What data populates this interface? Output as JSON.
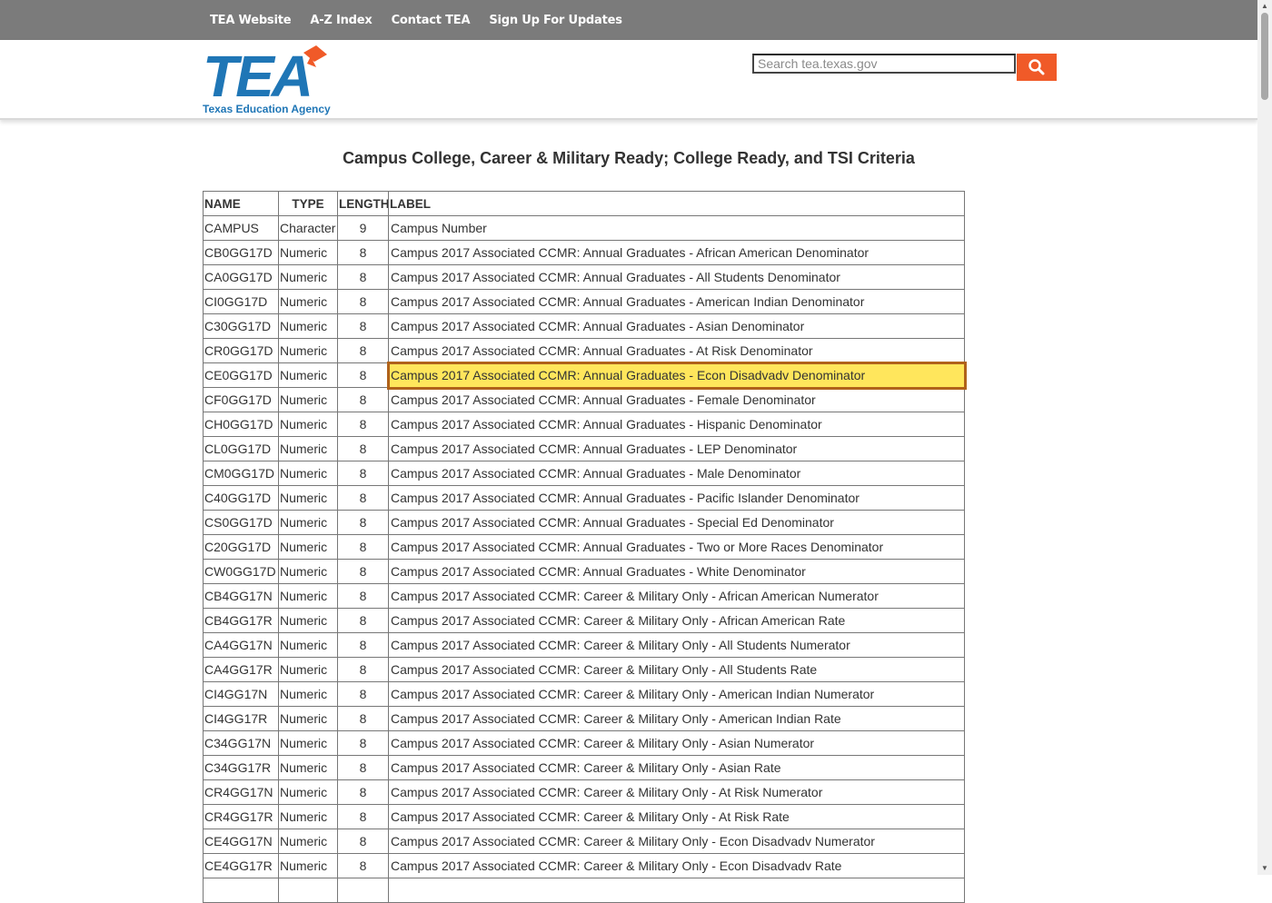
{
  "topnav": {
    "links": [
      "TEA Website",
      "A-Z Index",
      "Contact TEA",
      "Sign Up For Updates"
    ]
  },
  "header": {
    "logo_text": "TEA",
    "logo_subtext": "Texas Education Agency",
    "search_placeholder": "Search tea.texas.gov",
    "search_icon": "search-icon"
  },
  "colors": {
    "topbar": "#7b7b7b",
    "logo_blue": "#1f76b6",
    "accent_orange": "#f05a28",
    "highlight_fill": "#ffe65c",
    "highlight_border": "#b0621a"
  },
  "page_title": "Campus College, Career & Military Ready; College Ready, and TSI Criteria",
  "table": {
    "columns": [
      "NAME",
      "TYPE",
      "LENGTH",
      "LABEL"
    ],
    "rows": [
      [
        "CAMPUS",
        "Character",
        "9",
        "Campus Number"
      ],
      [
        "CB0GG17D",
        "Numeric",
        "8",
        "Campus 2017 Associated CCMR: Annual Graduates - African American Denominator"
      ],
      [
        "CA0GG17D",
        "Numeric",
        "8",
        "Campus 2017 Associated CCMR: Annual Graduates - All Students Denominator"
      ],
      [
        "CI0GG17D",
        "Numeric",
        "8",
        "Campus 2017 Associated CCMR: Annual Graduates - American Indian Denominator"
      ],
      [
        "C30GG17D",
        "Numeric",
        "8",
        "Campus 2017 Associated CCMR: Annual Graduates - Asian Denominator"
      ],
      [
        "CR0GG17D",
        "Numeric",
        "8",
        "Campus 2017 Associated CCMR: Annual Graduates - At Risk Denominator"
      ],
      [
        "CE0GG17D",
        "Numeric",
        "8",
        "Campus 2017 Associated CCMR: Annual Graduates - Econ Disadvadv Denominator"
      ],
      [
        "CF0GG17D",
        "Numeric",
        "8",
        "Campus 2017 Associated CCMR: Annual Graduates - Female Denominator"
      ],
      [
        "CH0GG17D",
        "Numeric",
        "8",
        "Campus 2017 Associated CCMR: Annual Graduates - Hispanic Denominator"
      ],
      [
        "CL0GG17D",
        "Numeric",
        "8",
        "Campus 2017 Associated CCMR: Annual Graduates - LEP Denominator"
      ],
      [
        "CM0GG17D",
        "Numeric",
        "8",
        "Campus 2017 Associated CCMR: Annual Graduates - Male Denominator"
      ],
      [
        "C40GG17D",
        "Numeric",
        "8",
        "Campus 2017 Associated CCMR: Annual Graduates - Pacific Islander Denominator"
      ],
      [
        "CS0GG17D",
        "Numeric",
        "8",
        "Campus 2017 Associated CCMR: Annual Graduates - Special Ed Denominator"
      ],
      [
        "C20GG17D",
        "Numeric",
        "8",
        "Campus 2017 Associated CCMR: Annual Graduates - Two or More Races Denominator"
      ],
      [
        "CW0GG17D",
        "Numeric",
        "8",
        "Campus 2017 Associated CCMR: Annual Graduates - White Denominator"
      ],
      [
        "CB4GG17N",
        "Numeric",
        "8",
        "Campus 2017 Associated CCMR: Career & Military Only - African American Numerator"
      ],
      [
        "CB4GG17R",
        "Numeric",
        "8",
        "Campus 2017 Associated CCMR: Career & Military Only - African American Rate"
      ],
      [
        "CA4GG17N",
        "Numeric",
        "8",
        "Campus 2017 Associated CCMR: Career & Military Only - All Students Numerator"
      ],
      [
        "CA4GG17R",
        "Numeric",
        "8",
        "Campus 2017 Associated CCMR: Career & Military Only - All Students Rate"
      ],
      [
        "CI4GG17N",
        "Numeric",
        "8",
        "Campus 2017 Associated CCMR: Career & Military Only - American Indian Numerator"
      ],
      [
        "CI4GG17R",
        "Numeric",
        "8",
        "Campus 2017 Associated CCMR: Career & Military Only - American Indian Rate"
      ],
      [
        "C34GG17N",
        "Numeric",
        "8",
        "Campus 2017 Associated CCMR: Career & Military Only - Asian Numerator"
      ],
      [
        "C34GG17R",
        "Numeric",
        "8",
        "Campus 2017 Associated CCMR: Career & Military Only - Asian Rate"
      ],
      [
        "CR4GG17N",
        "Numeric",
        "8",
        "Campus 2017 Associated CCMR: Career & Military Only - At Risk Numerator"
      ],
      [
        "CR4GG17R",
        "Numeric",
        "8",
        "Campus 2017 Associated CCMR: Career & Military Only - At Risk Rate"
      ],
      [
        "CE4GG17N",
        "Numeric",
        "8",
        "Campus 2017 Associated CCMR: Career & Military Only - Econ Disadvadv Numerator"
      ],
      [
        "CE4GG17R",
        "Numeric",
        "8",
        "Campus 2017 Associated CCMR: Career & Military Only - Econ Disadvadv Rate"
      ],
      [
        "",
        "",
        "",
        ""
      ]
    ],
    "highlighted_row": 6
  }
}
